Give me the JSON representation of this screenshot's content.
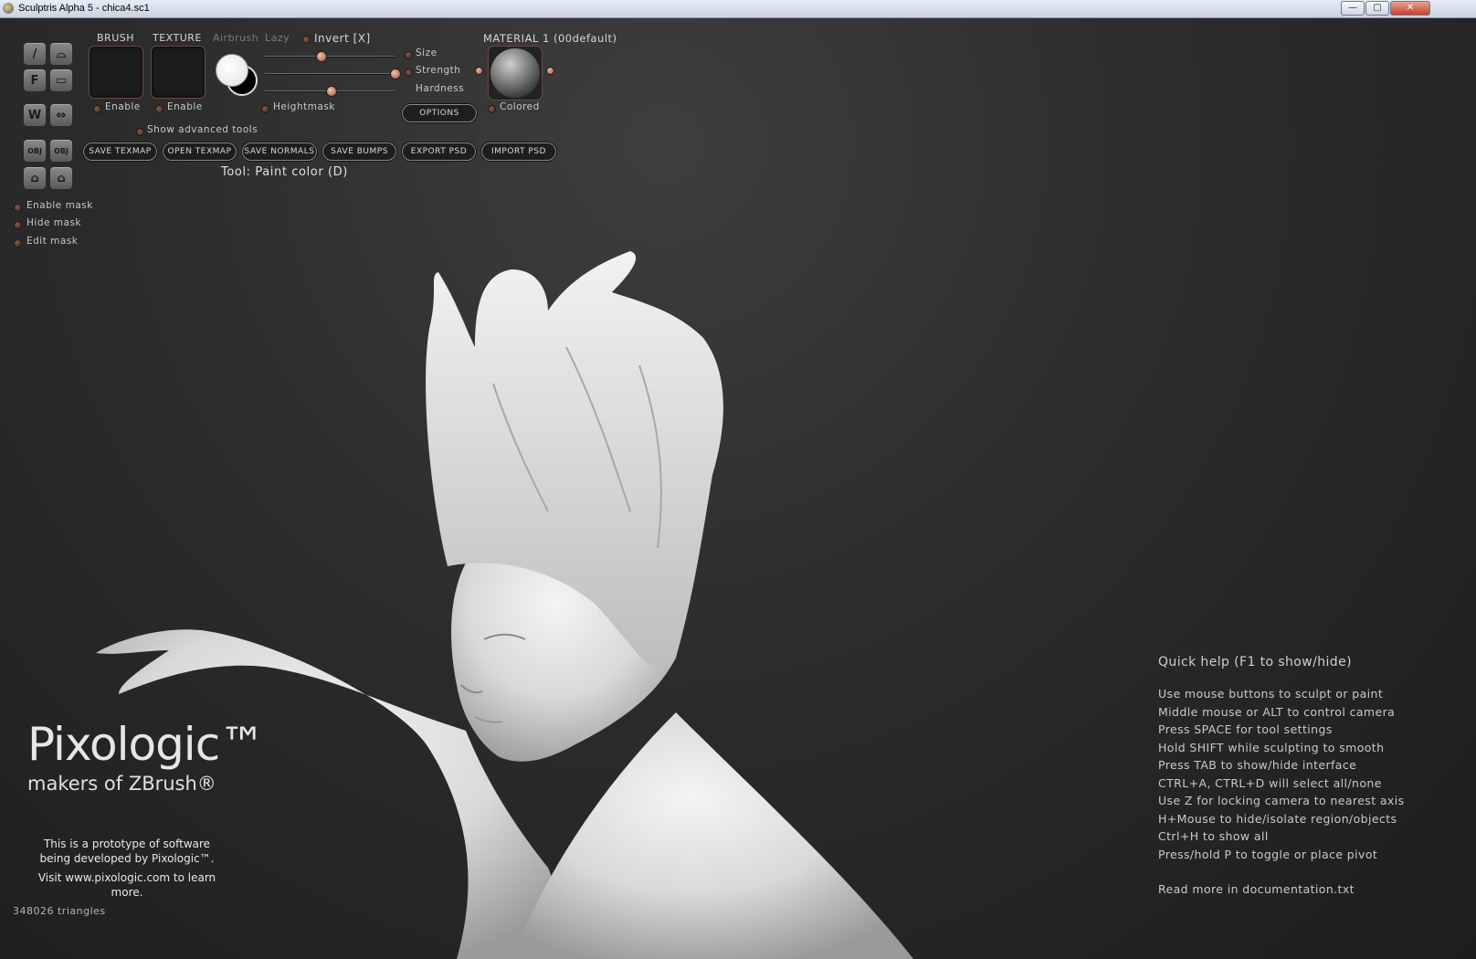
{
  "window": {
    "title": "Sculptris Alpha 5 - chica4.sc1",
    "controls": {
      "minimize": "—",
      "maximize": "▢",
      "close": "✕"
    }
  },
  "toolbar": {
    "tools": [
      {
        "glyph": "/",
        "icon": "draw-tool-icon"
      },
      {
        "glyph": "⌓",
        "icon": "inflate-tool-icon"
      },
      {
        "glyph": "F",
        "icon": "flatten-tool-icon"
      },
      {
        "glyph": "▭",
        "icon": "crease-tool-icon"
      },
      {
        "glyph": "W",
        "icon": "symmetry-icon"
      },
      {
        "glyph": "⇔",
        "icon": "mirror-icon"
      },
      {
        "glyph": "OBJ",
        "icon": "import-obj-icon"
      },
      {
        "glyph": "OBJ",
        "icon": "export-obj-icon"
      },
      {
        "glyph": "⌂",
        "icon": "open-file-icon"
      },
      {
        "glyph": "⌂",
        "icon": "save-file-icon"
      }
    ]
  },
  "brush": {
    "brush_label": "BRUSH",
    "texture_label": "TEXTURE",
    "airbrush_label": "Airbrush",
    "lazy_label": "Lazy",
    "invert_label": "Invert [X]",
    "enable_label": "Enable",
    "texture_enable_label": "Enable",
    "heightmask_label": "Heightmask",
    "size_label": "Size",
    "strength_label": "Strength",
    "hardness_label": "Hardness",
    "options_label": "OPTIONS",
    "show_advanced_label": "Show advanced tools",
    "sliders": {
      "size": 0.43,
      "strength": 1.0,
      "hardness": 0.51
    }
  },
  "material": {
    "label": "MATERIAL 1 (00default)",
    "colored_label": "Colored"
  },
  "file_buttons": [
    "SAVE TEXMAP",
    "OPEN TEXMAP",
    "SAVE NORMALS",
    "SAVE BUMPS",
    "EXPORT PSD",
    "IMPORT PSD"
  ],
  "tool_status": "Tool: Paint color (D)",
  "mask": {
    "enable": "Enable mask",
    "hide": "Hide mask",
    "edit": "Edit mask"
  },
  "quick_help": {
    "title": "Quick help (F1 to show/hide)",
    "lines": [
      "Use mouse buttons to sculpt or paint",
      "Middle mouse or ALT to control camera",
      "Press SPACE for tool settings",
      "Hold SHIFT while sculpting to smooth",
      "Press TAB to show/hide interface",
      "CTRL+A, CTRL+D will select all/none",
      "Use Z for locking camera to nearest axis",
      "H+Mouse to hide/isolate region/objects",
      "Ctrl+H to show all",
      "Press/hold P to toggle or place pivot"
    ],
    "footer": "Read more in documentation.txt"
  },
  "branding": {
    "logo": "Pixologic™",
    "makers": "makers of ZBrush®",
    "prototype_line1": "This is a prototype of software",
    "prototype_line2": "being developed by Pixologic™.",
    "visit": "Visit www.pixologic.com to learn more."
  },
  "status": {
    "triangles": "348026 triangles"
  },
  "colors": {
    "accent": "#c07a62",
    "background": "#2c2c2c",
    "primary_color": "#ffffff",
    "secondary_color": "#000000"
  }
}
